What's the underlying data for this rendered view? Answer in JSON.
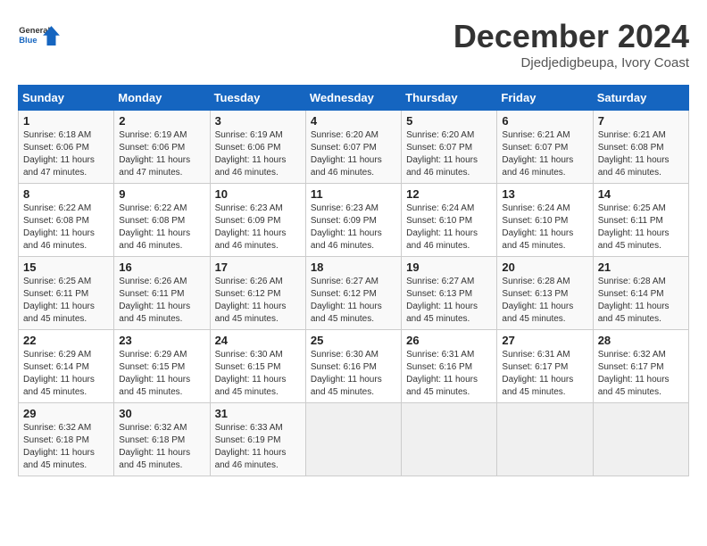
{
  "header": {
    "logo_line1": "General",
    "logo_line2": "Blue",
    "title": "December 2024",
    "subtitle": "Djedjedigbeupa, Ivory Coast"
  },
  "days_of_week": [
    "Sunday",
    "Monday",
    "Tuesday",
    "Wednesday",
    "Thursday",
    "Friday",
    "Saturday"
  ],
  "weeks": [
    [
      {
        "day": "1",
        "detail": "Sunrise: 6:18 AM\nSunset: 6:06 PM\nDaylight: 11 hours and 47 minutes."
      },
      {
        "day": "2",
        "detail": "Sunrise: 6:19 AM\nSunset: 6:06 PM\nDaylight: 11 hours and 47 minutes."
      },
      {
        "day": "3",
        "detail": "Sunrise: 6:19 AM\nSunset: 6:06 PM\nDaylight: 11 hours and 46 minutes."
      },
      {
        "day": "4",
        "detail": "Sunrise: 6:20 AM\nSunset: 6:07 PM\nDaylight: 11 hours and 46 minutes."
      },
      {
        "day": "5",
        "detail": "Sunrise: 6:20 AM\nSunset: 6:07 PM\nDaylight: 11 hours and 46 minutes."
      },
      {
        "day": "6",
        "detail": "Sunrise: 6:21 AM\nSunset: 6:07 PM\nDaylight: 11 hours and 46 minutes."
      },
      {
        "day": "7",
        "detail": "Sunrise: 6:21 AM\nSunset: 6:08 PM\nDaylight: 11 hours and 46 minutes."
      }
    ],
    [
      {
        "day": "8",
        "detail": "Sunrise: 6:22 AM\nSunset: 6:08 PM\nDaylight: 11 hours and 46 minutes."
      },
      {
        "day": "9",
        "detail": "Sunrise: 6:22 AM\nSunset: 6:08 PM\nDaylight: 11 hours and 46 minutes."
      },
      {
        "day": "10",
        "detail": "Sunrise: 6:23 AM\nSunset: 6:09 PM\nDaylight: 11 hours and 46 minutes."
      },
      {
        "day": "11",
        "detail": "Sunrise: 6:23 AM\nSunset: 6:09 PM\nDaylight: 11 hours and 46 minutes."
      },
      {
        "day": "12",
        "detail": "Sunrise: 6:24 AM\nSunset: 6:10 PM\nDaylight: 11 hours and 46 minutes."
      },
      {
        "day": "13",
        "detail": "Sunrise: 6:24 AM\nSunset: 6:10 PM\nDaylight: 11 hours and 45 minutes."
      },
      {
        "day": "14",
        "detail": "Sunrise: 6:25 AM\nSunset: 6:11 PM\nDaylight: 11 hours and 45 minutes."
      }
    ],
    [
      {
        "day": "15",
        "detail": "Sunrise: 6:25 AM\nSunset: 6:11 PM\nDaylight: 11 hours and 45 minutes."
      },
      {
        "day": "16",
        "detail": "Sunrise: 6:26 AM\nSunset: 6:11 PM\nDaylight: 11 hours and 45 minutes."
      },
      {
        "day": "17",
        "detail": "Sunrise: 6:26 AM\nSunset: 6:12 PM\nDaylight: 11 hours and 45 minutes."
      },
      {
        "day": "18",
        "detail": "Sunrise: 6:27 AM\nSunset: 6:12 PM\nDaylight: 11 hours and 45 minutes."
      },
      {
        "day": "19",
        "detail": "Sunrise: 6:27 AM\nSunset: 6:13 PM\nDaylight: 11 hours and 45 minutes."
      },
      {
        "day": "20",
        "detail": "Sunrise: 6:28 AM\nSunset: 6:13 PM\nDaylight: 11 hours and 45 minutes."
      },
      {
        "day": "21",
        "detail": "Sunrise: 6:28 AM\nSunset: 6:14 PM\nDaylight: 11 hours and 45 minutes."
      }
    ],
    [
      {
        "day": "22",
        "detail": "Sunrise: 6:29 AM\nSunset: 6:14 PM\nDaylight: 11 hours and 45 minutes."
      },
      {
        "day": "23",
        "detail": "Sunrise: 6:29 AM\nSunset: 6:15 PM\nDaylight: 11 hours and 45 minutes."
      },
      {
        "day": "24",
        "detail": "Sunrise: 6:30 AM\nSunset: 6:15 PM\nDaylight: 11 hours and 45 minutes."
      },
      {
        "day": "25",
        "detail": "Sunrise: 6:30 AM\nSunset: 6:16 PM\nDaylight: 11 hours and 45 minutes."
      },
      {
        "day": "26",
        "detail": "Sunrise: 6:31 AM\nSunset: 6:16 PM\nDaylight: 11 hours and 45 minutes."
      },
      {
        "day": "27",
        "detail": "Sunrise: 6:31 AM\nSunset: 6:17 PM\nDaylight: 11 hours and 45 minutes."
      },
      {
        "day": "28",
        "detail": "Sunrise: 6:32 AM\nSunset: 6:17 PM\nDaylight: 11 hours and 45 minutes."
      }
    ],
    [
      {
        "day": "29",
        "detail": "Sunrise: 6:32 AM\nSunset: 6:18 PM\nDaylight: 11 hours and 45 minutes."
      },
      {
        "day": "30",
        "detail": "Sunrise: 6:32 AM\nSunset: 6:18 PM\nDaylight: 11 hours and 45 minutes."
      },
      {
        "day": "31",
        "detail": "Sunrise: 6:33 AM\nSunset: 6:19 PM\nDaylight: 11 hours and 46 minutes."
      },
      {
        "day": "",
        "detail": ""
      },
      {
        "day": "",
        "detail": ""
      },
      {
        "day": "",
        "detail": ""
      },
      {
        "day": "",
        "detail": ""
      }
    ]
  ]
}
